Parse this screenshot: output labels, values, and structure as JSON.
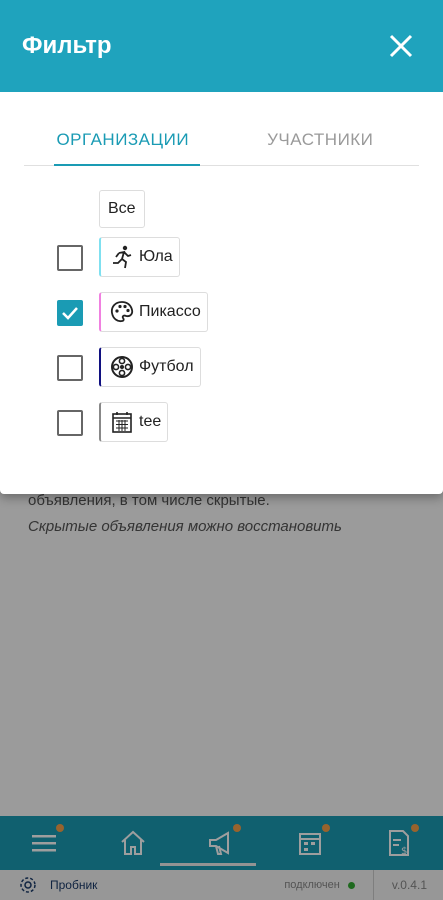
{
  "background": {
    "text_line1": "объявления, в том числе скрытые.",
    "text_line2": "Скрытые объявления можно восстановить",
    "status": {
      "user": "Пробник",
      "connection": "подключен",
      "version": "v.0.4.1"
    }
  },
  "dialog": {
    "title": "Фильтр",
    "tabs": [
      {
        "label": "ОРГАНИЗАЦИИ",
        "active": true
      },
      {
        "label": "УЧАСТНИКИ",
        "active": false
      }
    ],
    "all_label": "Все",
    "items": [
      {
        "label": "Юла",
        "checked": false,
        "icon": "running-person-icon",
        "color": "#7fe0f0"
      },
      {
        "label": "Пикассо",
        "checked": true,
        "icon": "palette-icon",
        "color": "#f080e0"
      },
      {
        "label": "Футбол",
        "checked": false,
        "icon": "film-reel-icon",
        "color": "#101080"
      },
      {
        "label": "tee",
        "checked": false,
        "icon": "calendar-icon",
        "color": "#888888"
      }
    ]
  },
  "colors": {
    "accent": "#1a9bb4",
    "header": "#1fa3bd",
    "notification_dot": "#f5a04a"
  }
}
